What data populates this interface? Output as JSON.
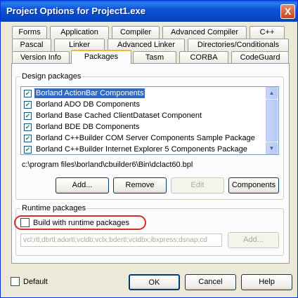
{
  "window": {
    "title": "Project Options for Project1.exe",
    "close_label": "X"
  },
  "tabs": {
    "row1": [
      "Forms",
      "Application",
      "Compiler",
      "Advanced Compiler",
      "C++"
    ],
    "row2": [
      "Pascal",
      "Linker",
      "Advanced Linker",
      "Directories/Conditionals"
    ],
    "row3": [
      "Version Info",
      "Packages",
      "Tasm",
      "CORBA",
      "CodeGuard"
    ],
    "active": "Packages"
  },
  "design_packages": {
    "label": "Design packages",
    "items": [
      {
        "label": "Borland ActionBar Components",
        "checked": true,
        "selected": true
      },
      {
        "label": "Borland ADO DB Components",
        "checked": true
      },
      {
        "label": "Borland Base Cached ClientDataset Component",
        "checked": true
      },
      {
        "label": "Borland BDE DB Components",
        "checked": true
      },
      {
        "label": "Borland C++Builder COM Server Components Sample Package",
        "checked": true
      },
      {
        "label": "Borland C++Builder Internet Explorer 5 Components Package",
        "checked": true
      }
    ],
    "path": "c:\\program files\\borland\\cbuilder6\\Bin\\dclact60.bpl",
    "buttons": {
      "add": "Add...",
      "remove": "Remove",
      "edit": "Edit",
      "components": "Components"
    }
  },
  "runtime_packages": {
    "label": "Runtime packages",
    "build_label": "Build with runtime packages",
    "build_checked": false,
    "packages_value": "vcl;rtl;dbrtl;adortl;vcldb;vclx;bdertl;vcldbx;ibxpress;dsnap;cd",
    "add": "Add..."
  },
  "footer": {
    "default_label": "Default",
    "default_checked": false,
    "ok": "OK",
    "cancel": "Cancel",
    "help": "Help"
  }
}
